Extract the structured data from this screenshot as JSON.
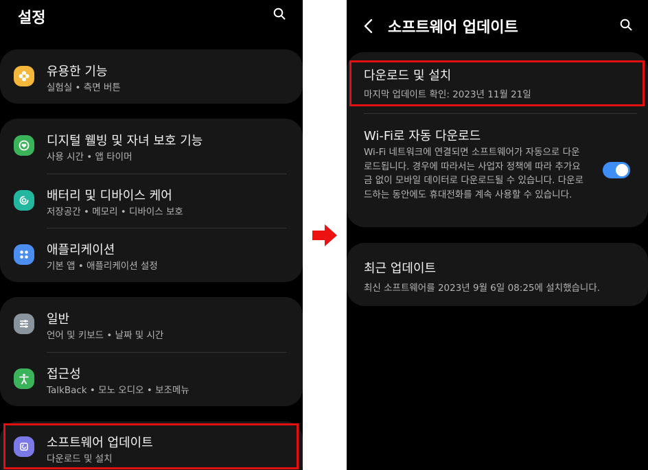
{
  "left": {
    "title": "설정",
    "groups": [
      {
        "items": [
          {
            "title": "유용한 기능",
            "subtitle": "실험실 • 측면 버튼",
            "icon": "flower-icon",
            "color": "#f5b73a"
          }
        ]
      },
      {
        "items": [
          {
            "title": "디지털 웰빙 및 자녀 보호 기능",
            "subtitle": "사용 시간 • 앱 타이머",
            "icon": "wellbeing-icon",
            "color": "#3bb35a"
          },
          {
            "title": "배터리 및 디바이스 케어",
            "subtitle": "저장공간 • 메모리 • 디바이스 보호",
            "icon": "device-care-icon",
            "color": "#24b79f"
          },
          {
            "title": "애플리케이션",
            "subtitle": "기본 앱 • 애플리케이션 설정",
            "icon": "apps-grid-icon",
            "color": "#4b8ef0"
          }
        ]
      },
      {
        "items": [
          {
            "title": "일반",
            "subtitle": "언어 및 키보드 • 날짜 및 시간",
            "icon": "sliders-icon",
            "color": "#8a949e"
          },
          {
            "title": "접근성",
            "subtitle": "TalkBack • 모노 오디오 • 보조메뉴",
            "icon": "accessibility-icon",
            "color": "#3bb35a"
          }
        ]
      },
      {
        "items": [
          {
            "title": "소프트웨어 업데이트",
            "subtitle": "다운로드 및 설치",
            "icon": "software-update-icon",
            "color": "#7b79e8"
          }
        ]
      }
    ]
  },
  "right": {
    "title": "소프트웨어 업데이트",
    "download": {
      "title": "다운로드 및 설치",
      "subtitle": "마지막 업데이트 확인: 2023년 11월 21일"
    },
    "wifi": {
      "title": "Wi-Fi로 자동 다운로드",
      "desc": "Wi-Fi 네트워크에 연결되면 소프트웨어가 자동으로 다운로드됩니다. 경우에 따라서는 사업자 정책에 따라 추가요금 없이 모바일 데이터로 다운로드될 수 있습니다. 다운로드하는 동안에도 휴대전화를 계속 사용할 수 있습니다.",
      "enabled": true
    },
    "recent": {
      "title": "최근 업데이트",
      "subtitle": "최신 소프트웨어를 2023년 9월 6일 08:25에 설치했습니다."
    }
  },
  "colors": {
    "highlight": "#e41010",
    "toggle_on": "#3e8ef5",
    "card": "#171717",
    "arrow": "#ee1111"
  }
}
